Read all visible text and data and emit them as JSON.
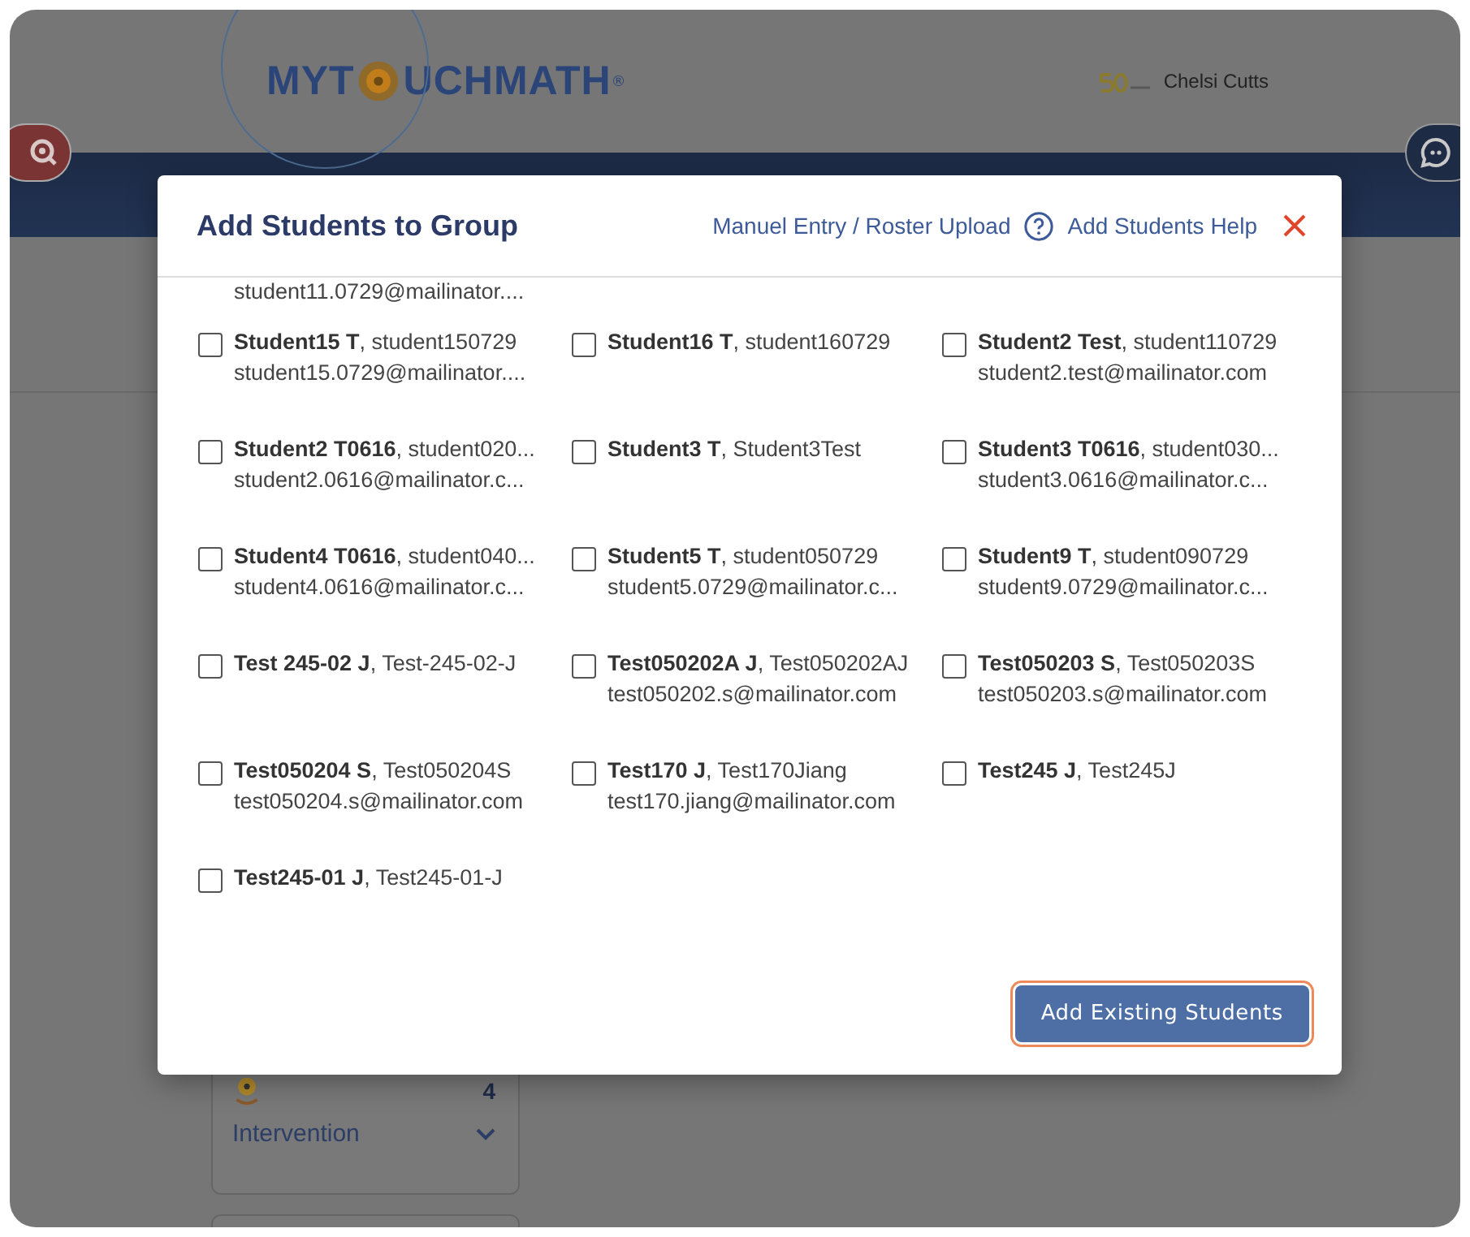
{
  "header": {
    "logo": {
      "before": "MYT",
      "after": "UCHMATH",
      "mark": "®"
    },
    "user_name": "Chelsi Cutts"
  },
  "sidebar_card": {
    "count": "4",
    "label": "Intervention"
  },
  "dialog": {
    "title": "Add Students to Group",
    "links": [
      "Manuel Entry / Roster Upload",
      "Add Students Help"
    ],
    "cut_line": "student11.0729@mailinator....",
    "students": [
      {
        "name": "Student15 T",
        "username": ", student150729",
        "email": "student15.0729@mailinator....",
        "checked": false
      },
      {
        "name": "Student16 T",
        "username": ", student160729",
        "checked": false
      },
      {
        "name": "Student2 Test",
        "username": ", student110729",
        "email": "student2.test@mailinator.com",
        "checked": false
      },
      {
        "name": "Student2 T0616",
        "username": ", student020...",
        "email": "student2.0616@mailinator.c...",
        "checked": false
      },
      {
        "name": "Student3 T",
        "username": ", Student3Test",
        "checked": false
      },
      {
        "name": "Student3 T0616",
        "username": ", student030...",
        "email": "student3.0616@mailinator.c...",
        "checked": false
      },
      {
        "name": "Student4 T0616",
        "username": ", student040...",
        "email": "student4.0616@mailinator.c...",
        "checked": false
      },
      {
        "name": "Student5 T",
        "username": ", student050729",
        "email": "student5.0729@mailinator.c...",
        "checked": false
      },
      {
        "name": "Student9 T",
        "username": ", student090729",
        "email": "student9.0729@mailinator.c...",
        "checked": false
      },
      {
        "name": "Test 245-02 J",
        "username": ", Test-245-02-J",
        "checked": false
      },
      {
        "name": "Test050202A J",
        "username": ", Test050202AJ",
        "email": "test050202.s@mailinator.com",
        "checked": false
      },
      {
        "name": "Test050203 S",
        "username": ", Test050203S",
        "email": "test050203.s@mailinator.com",
        "checked": false
      },
      {
        "name": "Test050204 S",
        "username": ", Test050204S",
        "email": "test050204.s@mailinator.com",
        "checked": false
      },
      {
        "name": "Test170 J",
        "username": ", Test170Jiang",
        "email": "test170.jiang@mailinator.com",
        "checked": false
      },
      {
        "name": "Test245 J",
        "username": ", Test245J",
        "checked": false
      },
      {
        "name": "Test245-01 J",
        "username": ", Test245-01-J",
        "checked": false
      }
    ],
    "button": "Add Existing Students"
  }
}
